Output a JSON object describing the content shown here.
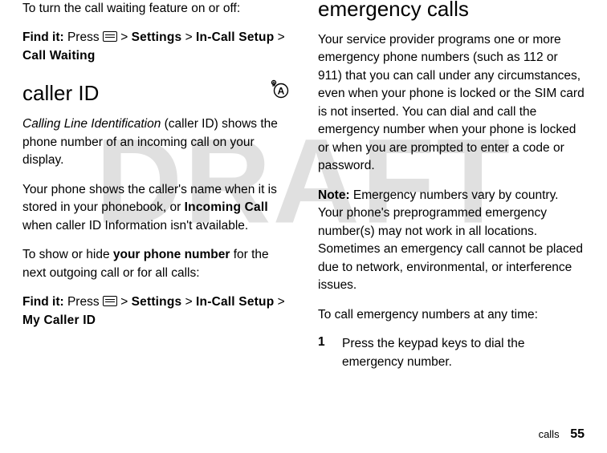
{
  "watermark": "DRAFT",
  "left": {
    "intro": "To turn the call waiting feature on or off:",
    "find1_a": "Find it:",
    "find1_b": "Press",
    "gt": ">",
    "settings": "Settings",
    "incall": "In-Call Setup",
    "callwaiting": "Call Waiting",
    "h_callerid": "caller ID",
    "cli_label": "Calling Line Identification",
    "cli_rest": " (caller ID) shows the phone number of an incoming call on your display.",
    "p3a": "Your phone shows the caller's name when it is stored in your phonebook, or ",
    "incoming": "Incoming Call",
    "p3b": " when caller ID Information isn't available.",
    "p4a": "To show or hide ",
    "your_number": "your phone number",
    "p4b": " for the next outgoing call or for all calls:",
    "find2_a": "Find it:",
    "find2_b": "Press",
    "mycaller": "My Caller ID"
  },
  "right": {
    "h_emergency": "emergency calls",
    "p1": "Your service provider programs one or more emergency phone numbers (such as 112 or 911) that you can call under any circumstances, even when your phone is locked or the SIM card is not inserted. You can dial and call the emergency number when your phone is locked or when you are prompted to enter a code or password.",
    "note_label": "Note:",
    "note_body": " Emergency numbers vary by country. Your phone's preprogrammed emergency number(s) may not work in all locations. Sometimes an emergency call cannot be placed due to network, environmental, or interference issues.",
    "p3": "To call emergency numbers at any time:",
    "step1_num": "1",
    "step1_txt": "Press the keypad keys to dial the emergency number."
  },
  "footer": {
    "section": "calls",
    "page": "55"
  }
}
